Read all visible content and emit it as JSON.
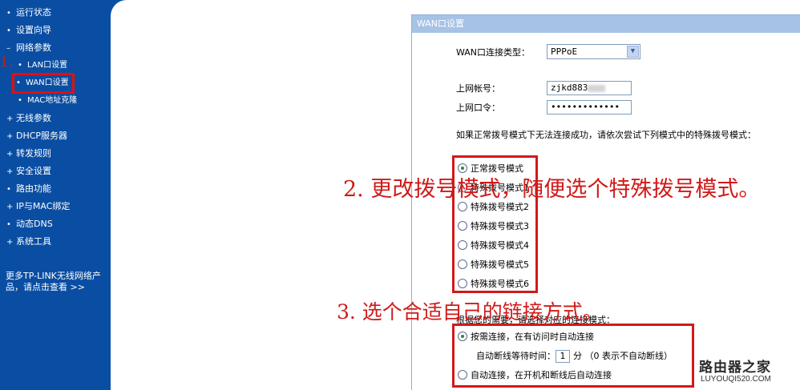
{
  "sidebar": {
    "items": [
      {
        "label": "运行状态",
        "bullet": "•"
      },
      {
        "label": "设置向导",
        "bullet": "•"
      },
      {
        "label": "网络参数",
        "bullet": "–"
      },
      {
        "label": "LAN口设置",
        "bullet": "•"
      },
      {
        "label": "WAN口设置",
        "bullet": "•"
      },
      {
        "label": "MAC地址克隆",
        "bullet": "•"
      },
      {
        "label": "无线参数",
        "bullet": "+"
      },
      {
        "label": "DHCP服务器",
        "bullet": "+"
      },
      {
        "label": "转发规则",
        "bullet": "+"
      },
      {
        "label": "安全设置",
        "bullet": "+"
      },
      {
        "label": "路由功能",
        "bullet": "•"
      },
      {
        "label": "IP与MAC绑定",
        "bullet": "+"
      },
      {
        "label": "动态DNS",
        "bullet": "•"
      },
      {
        "label": "系统工具",
        "bullet": "+"
      }
    ],
    "more_text": "更多TP-LINK无线网络产品，请点击查看 >>"
  },
  "panel": {
    "title": "WAN口设置",
    "connection_type_label": "WAN口连接类型：",
    "connection_type_value": "PPPoE",
    "account_label": "上网帐号：",
    "account_value": "zjkd883",
    "password_label": "上网口令：",
    "password_value": "•••••••••••••",
    "dial_hint": "如果正常拨号模式下无法连接成功，请依次尝试下列模式中的特殊拨号模式：",
    "dial_modes": [
      "正常拨号模式",
      "特殊拨号模式1",
      "特殊拨号模式2",
      "特殊拨号模式3",
      "特殊拨号模式4",
      "特殊拨号模式5",
      "特殊拨号模式6"
    ],
    "conn_mode_hint": "根据您的需要，请选择对应的连接模式：",
    "conn_on_demand": "按需连接，在有访问时自动连接",
    "idle_label": "自动断线等待时间：",
    "idle_value": "1",
    "idle_suffix": "分 （0 表示不自动断线）",
    "conn_auto": "自动连接，在开机和断线后自动连接"
  },
  "annotations": {
    "step1": "1.",
    "step2": "2. 更改拨号模式，随便选个特殊拨号模式。",
    "step3": "3. 选个合适自己的链接方式。"
  },
  "watermark": {
    "name": "路由器之家",
    "url": "LUYOUQI520.COM"
  },
  "colors": {
    "sidebar_bg": "#0a4ea3",
    "panel_header_bg": "#a6c3e6",
    "annotation_red": "#d01a1a"
  }
}
